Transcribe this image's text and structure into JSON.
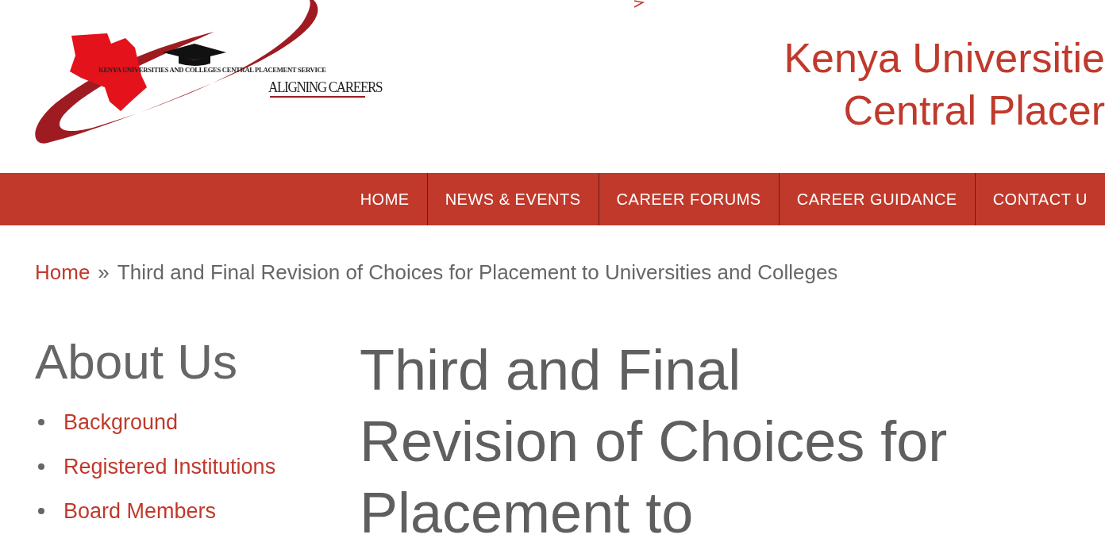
{
  "logo": {
    "line_1": "KENYA UNIVERSITIES AND COLLEGES CENTRAL PLACEMENT SERVICE",
    "line_2": "ALIGNING CAREERS"
  },
  "site_title": [
    "Kenya Universitie",
    "Central Placer"
  ],
  "nav": [
    {
      "label": "HOME"
    },
    {
      "label": "NEWS & EVENTS"
    },
    {
      "label": "CAREER FORUMS"
    },
    {
      "label": "CAREER GUIDANCE"
    },
    {
      "label": "CONTACT U"
    }
  ],
  "breadcrumb": {
    "home": "Home",
    "separator": "»",
    "current": "Third and Final Revision of Choices for Placement to Universities and Colleges"
  },
  "sidebar": {
    "heading": "About Us",
    "links": [
      "Background",
      "Registered Institutions",
      "Board Members"
    ]
  },
  "article": {
    "title_lines": [
      "Third and Final",
      "Revision of Choices for",
      "Placement to"
    ]
  }
}
